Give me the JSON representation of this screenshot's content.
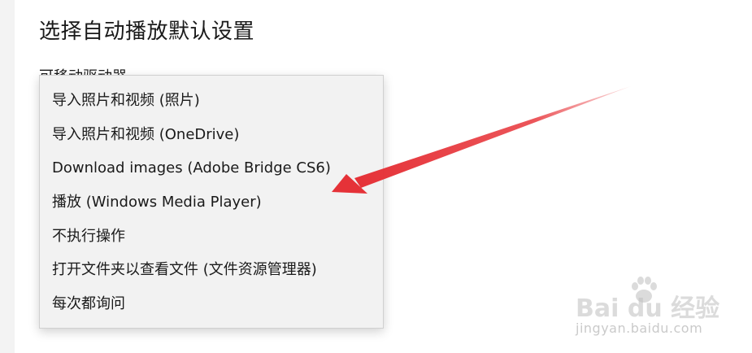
{
  "page": {
    "title": "选择自动播放默认设置",
    "section_label": "可移动驱动器"
  },
  "dropdown": {
    "options": [
      "导入照片和视频 (照片)",
      "导入照片和视频 (OneDrive)",
      "Download images (Adobe Bridge CS6)",
      "播放 (Windows Media Player)",
      "不执行操作",
      "打开文件夹以查看文件 (文件资源管理器)",
      "每次都询问"
    ]
  },
  "annotation": {
    "arrow_color": "#e8383d",
    "points_to": "播放 (Windows Media Player)"
  },
  "watermark": {
    "logo_text": "Bai du 经验",
    "url": "jingyan.baidu.com",
    "paw_icon": "baidu-paw-icon"
  },
  "colors": {
    "background": "#ffffff",
    "menu_background": "#f2f2f2",
    "text": "#1a1a1a"
  }
}
